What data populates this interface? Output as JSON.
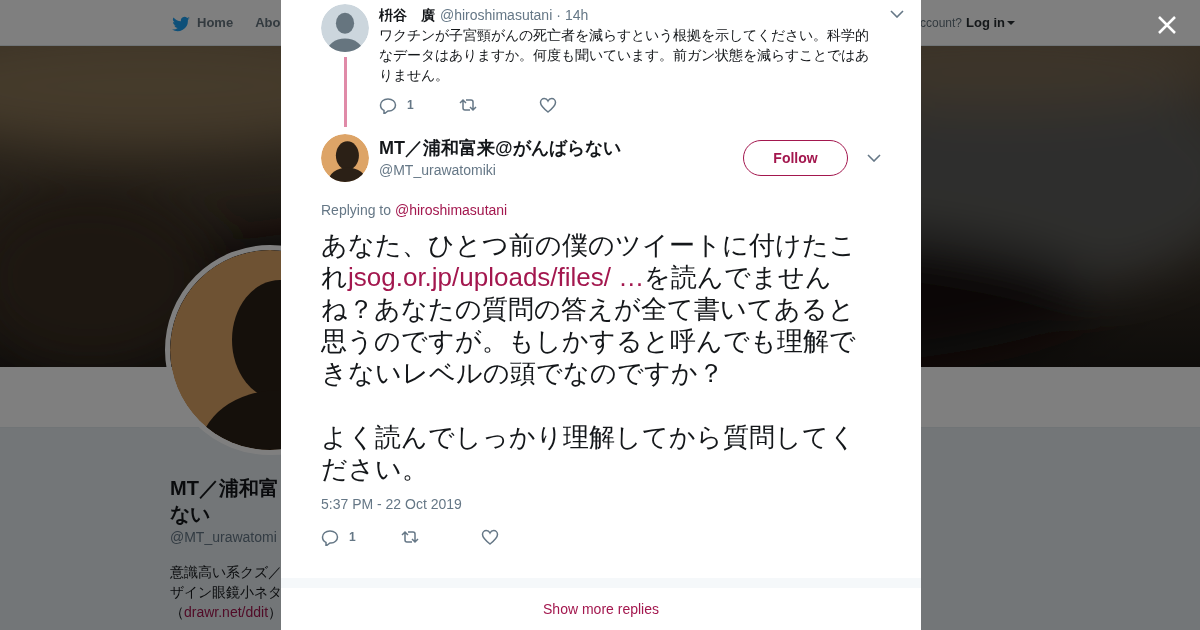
{
  "nav": {
    "home": "Home",
    "about": "Abo",
    "account_prompt": "ccount?",
    "login": "Log in"
  },
  "profile": {
    "name_lines": [
      "MT／浦和富",
      "ない"
    ],
    "handle": "@MT_urawatomi",
    "bio": [
      {
        "kind": "text",
        "text": "意識高い系クズ／"
      },
      {
        "kind": "text",
        "text": "ザイン眼鏡小ネタ"
      },
      {
        "kind": "link",
        "before": "（",
        "link": "drawr.net/ddit",
        "after": "）"
      }
    ]
  },
  "parent_tweet": {
    "name": "枡谷　廣",
    "handle": "@hiroshimasutani",
    "separator": "·",
    "time": "14h",
    "text": "ワクチンが子宮頸がんの死亡者を減らすという根拠を示してください。科学的なデータはありますか。何度も聞いています。前ガン状態を減らすことではありません。",
    "replies": "1"
  },
  "tweet": {
    "name": "MT／浦和富来@がんばらない",
    "handle": "@MT_urawatomiki",
    "follow": "Follow",
    "replying_label": "Replying to",
    "replying_to": "@hiroshimasutani",
    "text": [
      {
        "kind": "text",
        "text": "あなた、ひとつ前の僕のツイートに付けたこれ"
      },
      {
        "kind": "link",
        "text": "jsog.or.jp/uploads/files/ …"
      },
      {
        "kind": "text",
        "text": "を読んでませんね？あなたの質問の答えが全て書いてあると思うのですが。もしかすると呼んでも理解できないレベルの頭でなのですか？"
      }
    ],
    "text_2": "よく読んでしっかり理解してから質問してください。",
    "timestamp": "5:37 PM - 22 Oct 2019",
    "replies": "1"
  },
  "show_more": "Show more replies"
}
